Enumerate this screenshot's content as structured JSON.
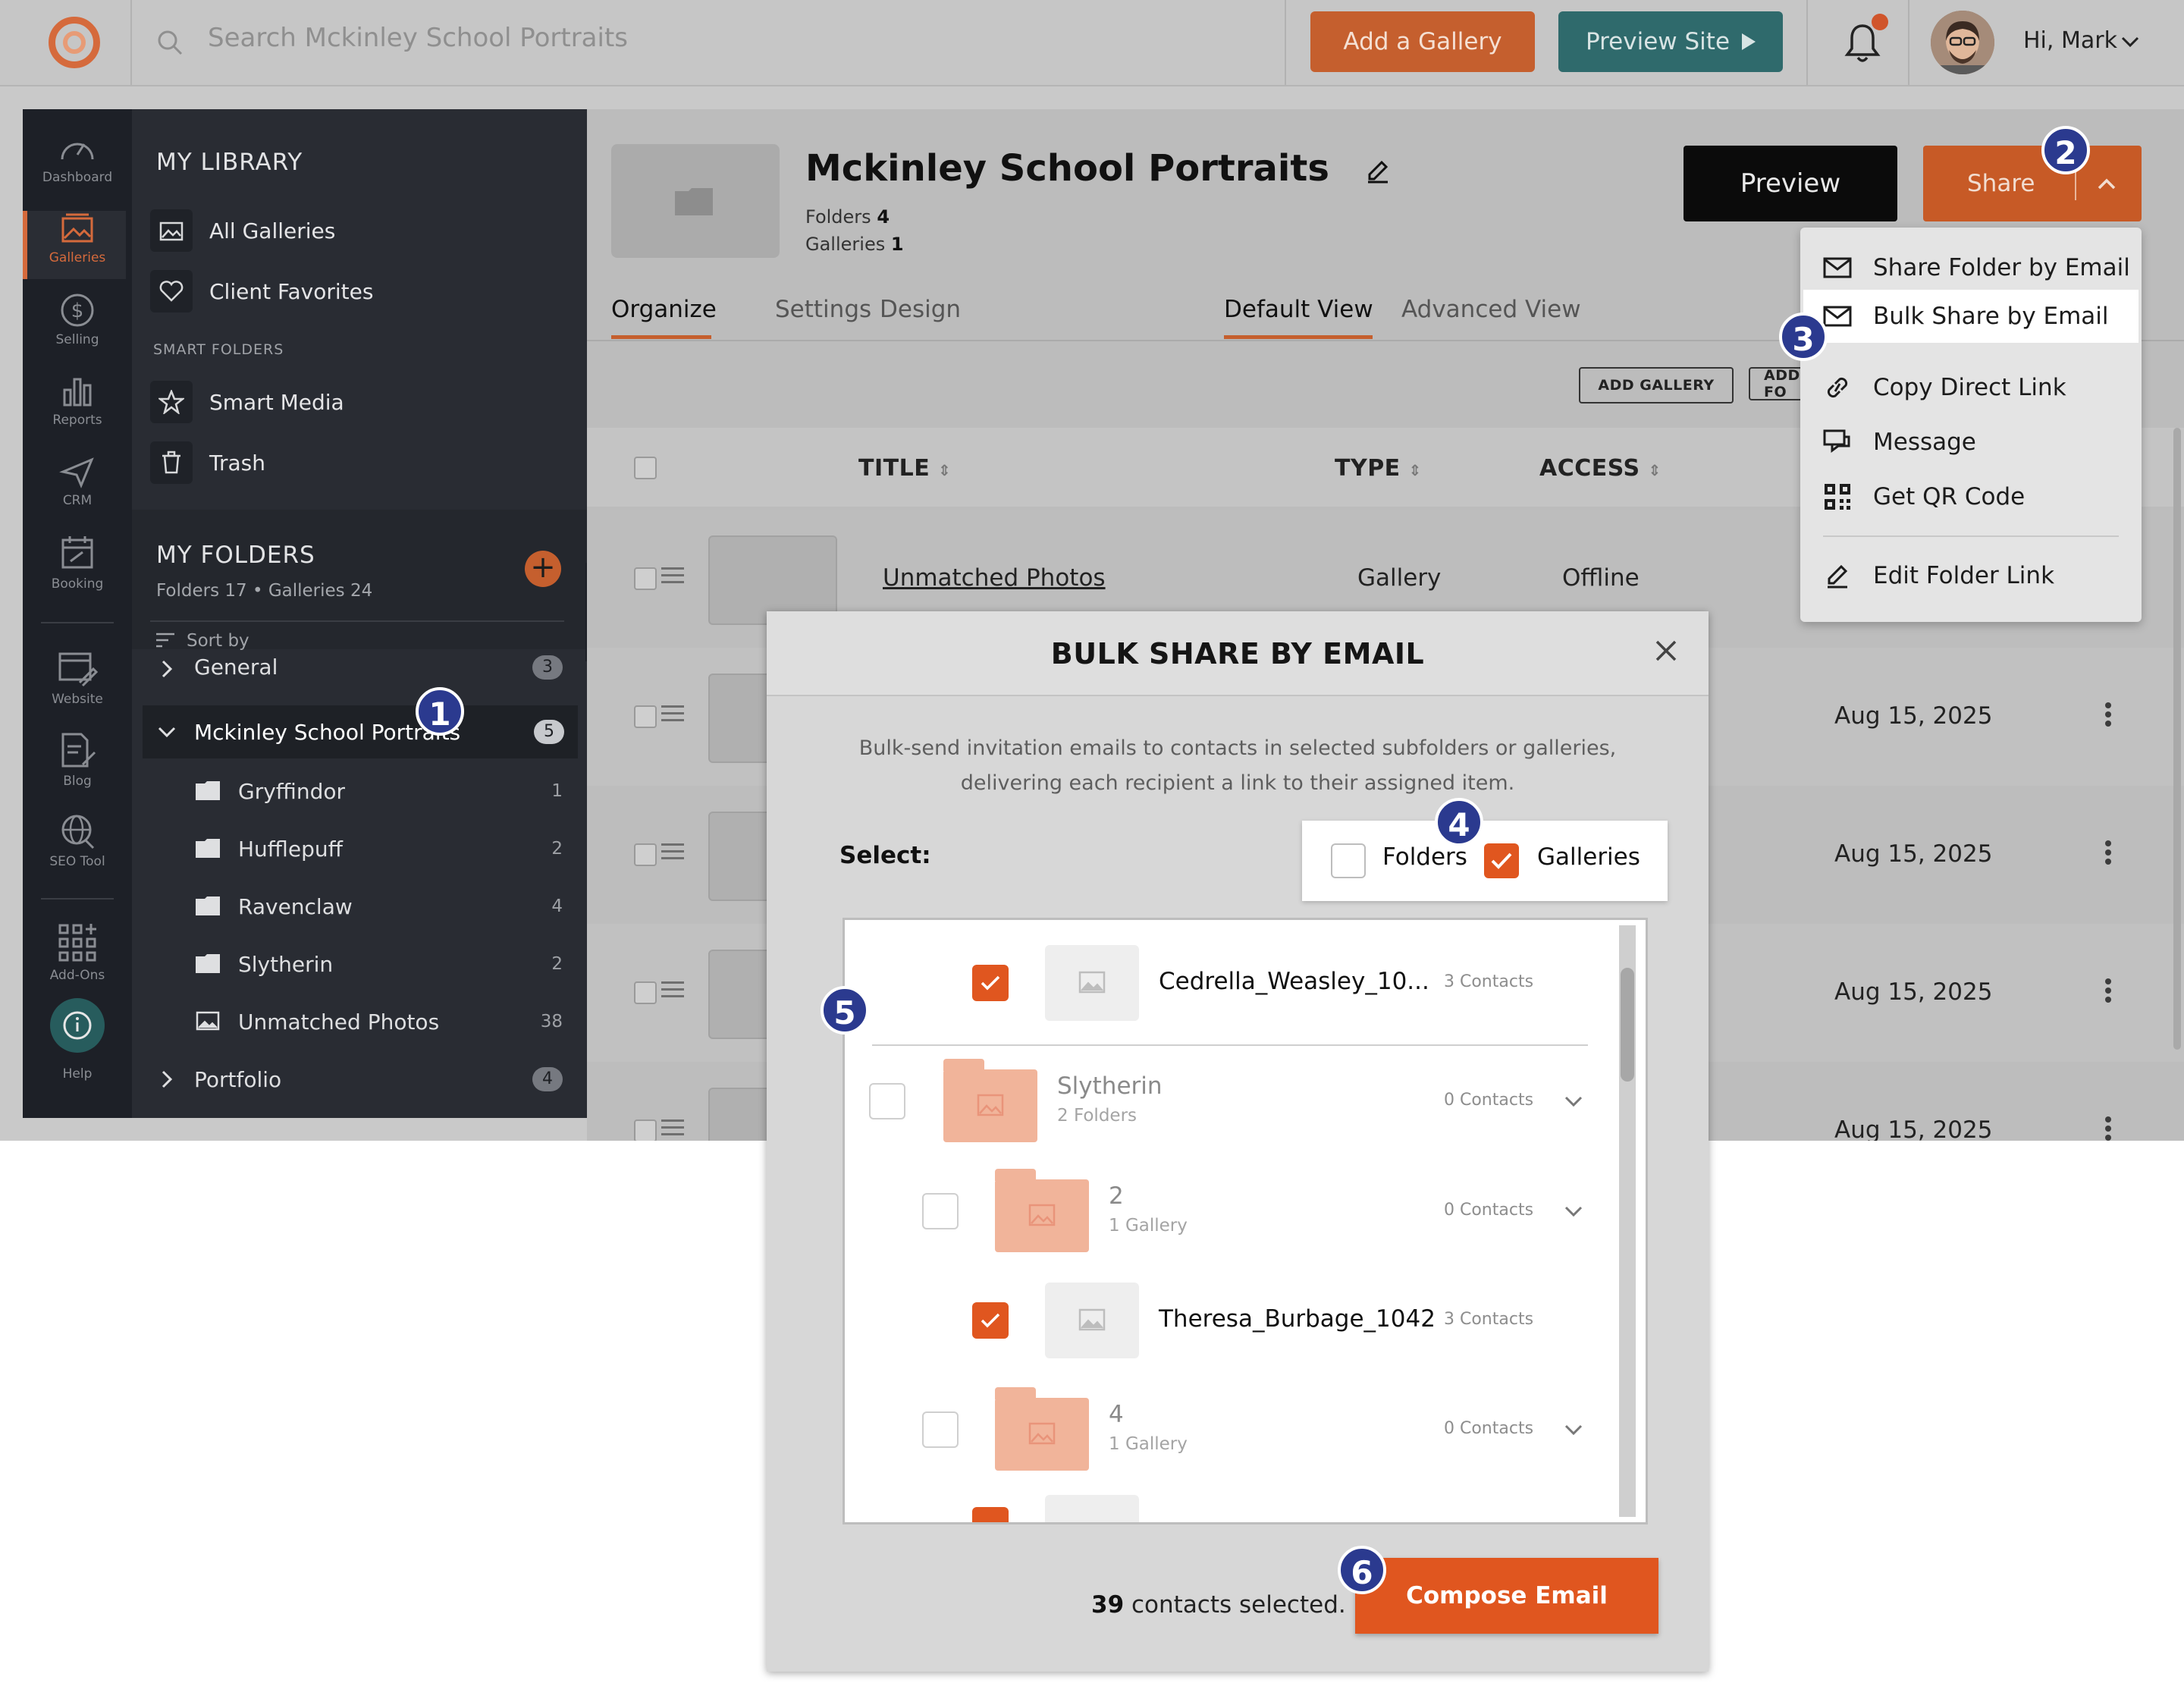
{
  "topbar": {
    "search_placeholder": "Search Mckinley School Portraits",
    "add_gallery_label": "Add a Gallery",
    "preview_site_label": "Preview Site",
    "greeting": "Hi, Mark",
    "notification_dot": true,
    "colors": {
      "add_gallery": "#c55f2e",
      "preview_site": "#2f6a6c"
    }
  },
  "rail": {
    "items": [
      {
        "label": "Dashboard",
        "icon": "gauge-icon"
      },
      {
        "label": "Galleries",
        "icon": "gallery-icon",
        "active": true
      },
      {
        "label": "Selling",
        "icon": "dollar-icon"
      },
      {
        "label": "Reports",
        "icon": "bar-chart-icon"
      },
      {
        "label": "CRM",
        "icon": "send-icon"
      },
      {
        "label": "Booking",
        "icon": "calendar-icon"
      },
      {
        "label": "Website",
        "icon": "website-icon"
      },
      {
        "label": "Blog",
        "icon": "blog-icon"
      },
      {
        "label": "SEO Tool",
        "icon": "globe-search-icon"
      },
      {
        "label": "Add-Ons",
        "icon": "grid-plus-icon"
      },
      {
        "label": "Help",
        "icon": "help-icon"
      }
    ]
  },
  "library": {
    "heading": "MY LIBRARY",
    "all_galleries": "All Galleries",
    "client_favorites": "Client Favorites",
    "smart_folders_heading": "SMART FOLDERS",
    "smart_media": "Smart Media",
    "trash": "Trash"
  },
  "my_folders": {
    "heading": "MY FOLDERS",
    "stats": "Folders 17 • Galleries 24",
    "sort_by": "Sort by",
    "tree": [
      {
        "label": "General",
        "count": "3",
        "level": 0,
        "pill": true
      },
      {
        "label": "Mckinley School Portraits",
        "count": "5",
        "level": 0,
        "pill": true,
        "expanded": true,
        "selected": true
      },
      {
        "label": "Gryffindor",
        "count": "1",
        "level": 1,
        "icon": "folder"
      },
      {
        "label": "Hufflepuff",
        "count": "2",
        "level": 1,
        "icon": "folder"
      },
      {
        "label": "Ravenclaw",
        "count": "4",
        "level": 1,
        "icon": "folder"
      },
      {
        "label": "Slytherin",
        "count": "2",
        "level": 1,
        "icon": "folder"
      },
      {
        "label": "Unmatched Photos",
        "count": "38",
        "level": 1,
        "icon": "image"
      },
      {
        "label": "Portfolio",
        "count": "4",
        "level": 0,
        "pill": true
      }
    ]
  },
  "header": {
    "title": "Mckinley School Portraits",
    "folders_label": "Folders",
    "folders_count": "4",
    "galleries_label": "Galleries",
    "galleries_count": "1",
    "preview_label": "Preview",
    "share_label": "Share"
  },
  "tabs": [
    "Organize",
    "Settings",
    "Design"
  ],
  "view_tabs": [
    "Default View",
    "Advanced View"
  ],
  "toolbar": {
    "add_gallery": "ADD GALLERY",
    "add_folder": "ADD FO"
  },
  "table": {
    "columns": [
      "TITLE",
      "TYPE",
      "ACCESS"
    ],
    "rows": [
      {
        "title": "Unmatched Photos",
        "type": "Gallery",
        "access": "Offline",
        "date": ""
      },
      {
        "title": "",
        "type": "",
        "access": "",
        "date": "Aug 15, 2025"
      },
      {
        "title": "",
        "type": "",
        "access": "",
        "date": "Aug 15, 2025"
      },
      {
        "title": "",
        "type": "",
        "access": "",
        "date": "Aug 15, 2025"
      },
      {
        "title": "",
        "type": "",
        "access": "",
        "date": "Aug 15, 2025"
      }
    ]
  },
  "share_menu": {
    "items": [
      {
        "label": "Share Folder by Email",
        "icon": "envelope-icon"
      },
      {
        "label": "Bulk Share by Email",
        "icon": "envelope-icon",
        "highlighted": true
      },
      {
        "label": "Copy Direct Link",
        "icon": "link-icon"
      },
      {
        "label": "Message",
        "icon": "chat-icon"
      },
      {
        "label": "Get QR Code",
        "icon": "qr-code-icon"
      },
      {
        "label": "Edit Folder Link",
        "icon": "pencil-icon"
      }
    ]
  },
  "modal": {
    "title": "BULK SHARE BY EMAIL",
    "description": "Bulk-send invitation emails to contacts in selected subfolders or galleries, delivering each recipient a link to their assigned item.",
    "select_label": "Select:",
    "filter_folders": "Folders",
    "filter_galleries": "Galleries",
    "filter_folders_checked": false,
    "filter_galleries_checked": true,
    "items": [
      {
        "title": "Cedrella_Weasley_10...",
        "sub": "",
        "contacts": "3 Contacts",
        "kind": "gallery",
        "checked": true,
        "indent": 1
      },
      {
        "title": "Slytherin",
        "sub": "2 Folders",
        "contacts": "0 Contacts",
        "kind": "folder",
        "checked": false,
        "indent": 0
      },
      {
        "title": "2",
        "sub": "1 Gallery",
        "contacts": "0 Contacts",
        "kind": "folder",
        "checked": false,
        "indent": 1
      },
      {
        "title": "Theresa_Burbage_1042",
        "sub": "",
        "contacts": "3 Contacts",
        "kind": "gallery",
        "checked": true,
        "indent": 1
      },
      {
        "title": "4",
        "sub": "1 Gallery",
        "contacts": "0 Contacts",
        "kind": "folder",
        "checked": false,
        "indent": 1
      }
    ],
    "selected_count": "39",
    "selected_suffix": "contacts selected.",
    "compose_label": "Compose Email",
    "accent": "#e0561f"
  },
  "step_markers": [
    "1",
    "2",
    "3",
    "4",
    "5",
    "6"
  ]
}
